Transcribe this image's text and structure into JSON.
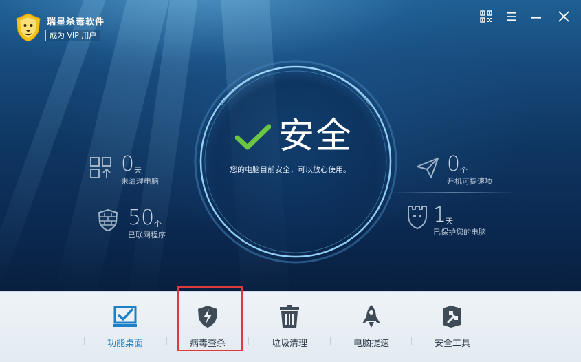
{
  "app": {
    "title": "瑞星杀毒软件",
    "vip_label": "成为 VIP 用户"
  },
  "window_controls": {
    "icons": [
      "qr-code-icon",
      "menu-icon",
      "minimize-icon",
      "close-icon"
    ]
  },
  "status": {
    "title": "安全",
    "description": "您的电脑目前安全，可以放心使用。",
    "check_color": "#6cc644"
  },
  "stats": {
    "uncleaned": {
      "value": "0",
      "unit": "天",
      "label": "未清理电脑",
      "icon": "grid-upload-icon"
    },
    "networked": {
      "value": "50",
      "unit": "个",
      "label": "已联网程序",
      "icon": "firewall-shield-icon"
    },
    "boost": {
      "value": "0",
      "unit": "个",
      "label": "开机可提速项",
      "icon": "paper-plane-icon"
    },
    "protected": {
      "value": "1",
      "unit": "天",
      "label": "已保护您的电脑",
      "icon": "castle-shield-icon"
    }
  },
  "toolbar": {
    "items": [
      {
        "label": "功能桌面",
        "icon": "desktop-check-icon",
        "active": true
      },
      {
        "label": "病毒查杀",
        "icon": "shield-lightning-icon",
        "active": false
      },
      {
        "label": "垃圾清理",
        "icon": "trash-icon",
        "active": false
      },
      {
        "label": "电脑提速",
        "icon": "rocket-icon",
        "active": false
      },
      {
        "label": "安全工具",
        "icon": "toolbox-wrench-icon",
        "active": false
      }
    ]
  },
  "colors": {
    "accent": "#1d7fc5",
    "highlight": "#e0393b",
    "logo": "#f5c21b"
  }
}
